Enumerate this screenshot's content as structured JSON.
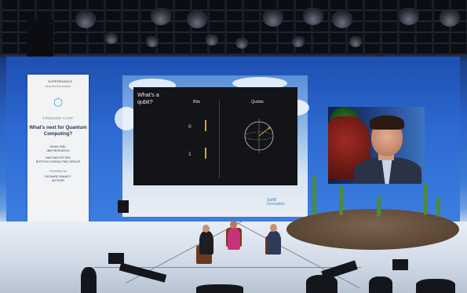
{
  "banner": {
    "logo": "SUPERRADIUS",
    "subtitle": "INNOVATIONS SUMMIT",
    "fireside": "FIRESIDE CHAT",
    "question": "What's next for Quantum Computing?",
    "speaker1_name": "HEIKE RIEL",
    "speaker1_org": "IBM RESEARCH",
    "speaker2_name": "MATHIAS RITTER",
    "speaker2_org": "BOSTON CONSULTING GROUP",
    "moderated": "Moderated by",
    "moderator_name": "RICHARD RANATY",
    "moderator_org": "AUTHOR"
  },
  "slide": {
    "title": "What's a qubit?",
    "bits_label": "Bits",
    "qubits_label": "Qubits",
    "bit0": "0",
    "bit1": "1"
  },
  "sponsor": {
    "line1": "SoftB",
    "line2": "Innovation"
  },
  "colors": {
    "stage_blue": "#2d6ad2",
    "slide_bg": "#121418",
    "bit_bar": "#e0a030",
    "chair_red": "#a02a22"
  }
}
